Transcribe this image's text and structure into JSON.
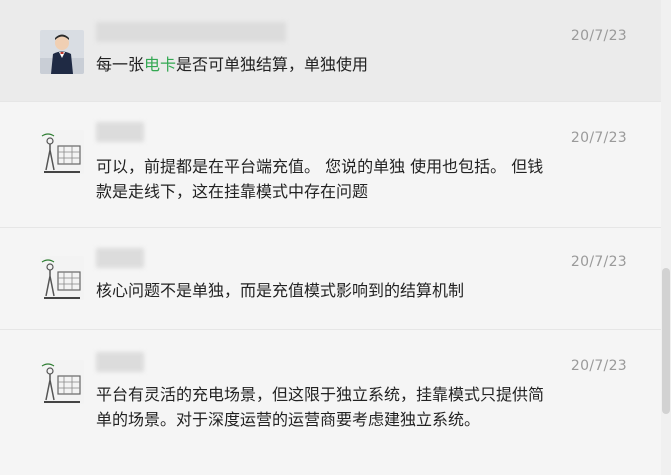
{
  "messages": [
    {
      "time": "20/7/23",
      "avatar_icon": "child-avatar-icon",
      "text_before": "每一张",
      "text_highlight": "电卡",
      "text_after": "是否可单独结算，单独使用"
    },
    {
      "time": "20/7/23",
      "avatar_icon": "sketch-avatar-icon",
      "text": "可以，前提都是在平台端充值。 您说的单独 使用也包括。 但钱款是走线下，这在挂靠模式中存在问题"
    },
    {
      "time": "20/7/23",
      "avatar_icon": "sketch-avatar-icon",
      "text": "核心问题不是单独，而是充值模式影响到的结算机制"
    },
    {
      "time": "20/7/23",
      "avatar_icon": "sketch-avatar-icon",
      "text": "平台有灵活的充电场景，但这限于独立系统，挂靠模式只提供简单的场景。对于深度运营的运营商要考虑建独立系统。"
    }
  ],
  "colors": {
    "highlight": "#34a853",
    "background": "#f5f5f5",
    "selected_row": "#ebebeb"
  }
}
